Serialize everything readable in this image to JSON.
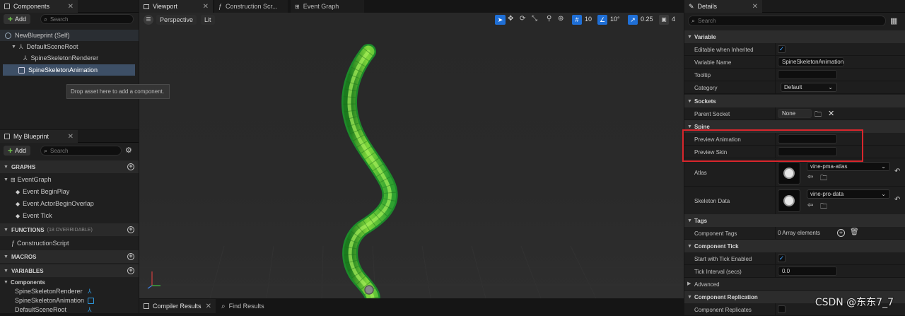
{
  "components_panel": {
    "tab_label": "Components",
    "add_label": "Add",
    "search_placeholder": "Search",
    "tree": [
      {
        "label": "NewBlueprint (Self)"
      },
      {
        "label": "DefaultSceneRoot"
      },
      {
        "label": "SpineSkeletonRenderer"
      },
      {
        "label": "SpineSkeletonAnimation"
      }
    ],
    "tooltip": "Drop asset here to add a component."
  },
  "my_blueprint": {
    "tab_label": "My Blueprint",
    "add_label": "Add",
    "search_placeholder": "Search",
    "sections": {
      "graphs": "GRAPHS",
      "functions": "FUNCTIONS",
      "functions_hint": "(18 OVERRIDABLE)",
      "macros": "MACROS",
      "variables": "VARIABLES"
    },
    "event_graph": "EventGraph",
    "events": [
      "Event BeginPlay",
      "Event ActorBeginOverlap",
      "Event Tick"
    ],
    "construction_script": "ConstructionScript",
    "components_category": "Components",
    "variables": [
      "SpineSkeletonRenderer",
      "SpineSkeletonAnimation",
      "DefaultSceneRoot"
    ]
  },
  "editor_tabs": [
    "Viewport",
    "Construction Scr...",
    "Event Graph"
  ],
  "viewport": {
    "perspective_label": "Perspective",
    "lit_label": "Lit",
    "grid_value": "10",
    "angle_value": "10°",
    "scale_value": "0.25",
    "camera_speed": "4"
  },
  "bottom_tabs": [
    "Compiler Results",
    "Find Results"
  ],
  "details": {
    "tab_label": "Details",
    "search_placeholder": "Search",
    "sections": {
      "variable": "Variable",
      "sockets": "Sockets",
      "spine": "Spine",
      "tags": "Tags",
      "component_tick": "Component Tick",
      "advanced": "Advanced",
      "component_replication": "Component Replication"
    },
    "rows": {
      "editable_when_inherited": "Editable when Inherited",
      "variable_name": "Variable Name",
      "variable_name_value": "SpineSkeletonAnimation",
      "tooltip": "Tooltip",
      "category": "Category",
      "category_value": "Default",
      "parent_socket": "Parent Socket",
      "parent_socket_value": "None",
      "preview_animation": "Preview Animation",
      "preview_skin": "Preview Skin",
      "atlas": "Atlas",
      "atlas_value": "vine-pma-atlas",
      "skeleton_data": "Skeleton Data",
      "skeleton_data_value": "vine-pro-data",
      "component_tags": "Component Tags",
      "component_tags_value": "0 Array elements",
      "start_with_tick": "Start with Tick Enabled",
      "tick_interval": "Tick Interval (secs)",
      "tick_interval_value": "0.0",
      "component_replicates": "Component Replicates"
    }
  },
  "watermark": "CSDN @东东7_7",
  "colors": {
    "highlight_box": "#d9262c",
    "selection": "#3d4f66",
    "checkbox_check": "#3ea0ff",
    "add_plus": "#6ec14b"
  }
}
